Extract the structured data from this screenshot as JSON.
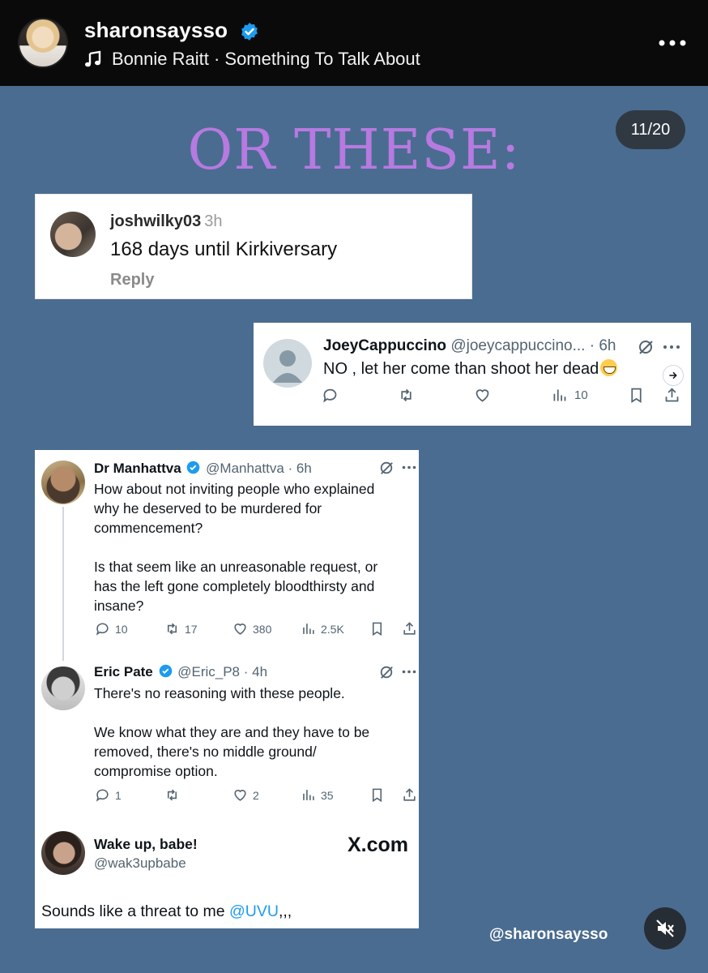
{
  "header": {
    "username": "sharonsaysso",
    "song": "Bonnie Raitt · Something To Talk About"
  },
  "slide": {
    "title": "OR THESE:",
    "counter": "11/20",
    "watermark": "@sharonsaysso"
  },
  "comment1": {
    "username": "joshwilky03",
    "time": "3h",
    "text": "168 days until Kirkiversary",
    "reply_label": "Reply"
  },
  "tweet1": {
    "name": "JoeyCappuccino",
    "handle_time": "@joeycappuccino... · 6h",
    "text": "NO , let her come than shoot her dead",
    "views": "10"
  },
  "thread": {
    "post1": {
      "name": "Dr Manhattva",
      "handle_time": "@Manhattva · 6h",
      "body": "How about not inviting people who explained\nwhy he deserved to be murdered for\ncommencement?\n\nIs that seem like an unreasonable request, or\nhas the left gone completely bloodthirsty and\ninsane?",
      "replies": "10",
      "reposts": "17",
      "likes": "380",
      "views": "2.5K"
    },
    "post2": {
      "name": "Eric Pate",
      "handle_time": "@Eric_P8 · 4h",
      "body": "There's no reasoning with these people.\n\nWe know what they are and they have to be\nremoved, there's no middle ground/\ncompromise option.",
      "replies": "1",
      "likes": "2",
      "views": "35"
    },
    "post3": {
      "name": "Wake up, babe!",
      "handle": "@wak3upbabe",
      "site": "X.com",
      "text_prefix": "Sounds like a threat to me ",
      "mention": "@UVU",
      "text_suffix": ",,,"
    }
  },
  "colors": {
    "slide_bg": "#4a6c90",
    "title": "#b67ae0",
    "verified": "#1d9bf0"
  }
}
